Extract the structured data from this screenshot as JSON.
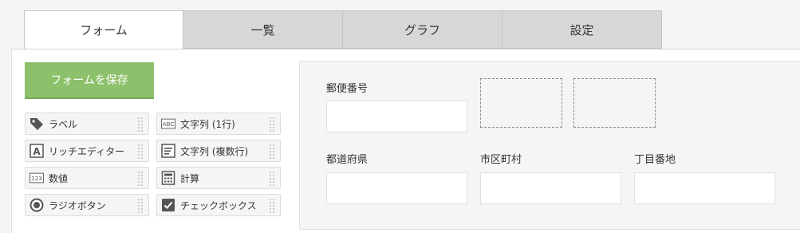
{
  "tabs": [
    {
      "label": "フォーム",
      "active": true
    },
    {
      "label": "一覧",
      "active": false
    },
    {
      "label": "グラフ",
      "active": false
    },
    {
      "label": "設定",
      "active": false
    }
  ],
  "save_button": {
    "label": "フォームを保存",
    "color": "#8cc06a"
  },
  "palette": [
    {
      "label": "ラベル",
      "icon": "tag-icon"
    },
    {
      "label": "文字列 (1行)",
      "icon": "abc-icon"
    },
    {
      "label": "リッチエディター",
      "icon": "rich-editor-icon"
    },
    {
      "label": "文字列 (複数行)",
      "icon": "multiline-text-icon"
    },
    {
      "label": "数値",
      "icon": "number-icon"
    },
    {
      "label": "計算",
      "icon": "calculator-icon"
    },
    {
      "label": "ラジオボタン",
      "icon": "radio-icon"
    },
    {
      "label": "チェックボックス",
      "icon": "checkbox-icon"
    }
  ],
  "form_fields": {
    "postal_code": {
      "label": "郵便番号",
      "value": ""
    },
    "prefecture": {
      "label": "都道府県",
      "value": ""
    },
    "city": {
      "label": "市区町村",
      "value": ""
    },
    "address": {
      "label": "丁目番地",
      "value": ""
    }
  },
  "icon_glyphs": {
    "abc": "ABC",
    "number": "123",
    "rich_editor": "A"
  }
}
